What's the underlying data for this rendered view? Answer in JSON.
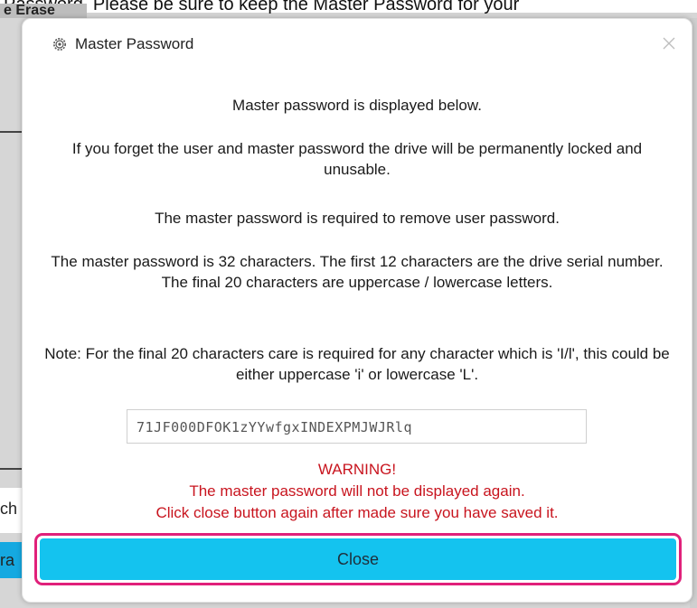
{
  "background": {
    "top_text": "Password. Please be sure to keep the Master Password for your",
    "tab_label": "e Erase",
    "left_fragment_1": "ch",
    "left_fragment_2": "ra"
  },
  "dialog": {
    "title": "Master Password",
    "app_icon": "gear-icon",
    "close_icon": "close-icon",
    "messages": [
      "Master password is displayed below.",
      "If you forget the user and master password the drive will be permanently locked and unusable.",
      "The master password is required to remove user password.",
      "The master password is 32 characters. The first 12 characters are the drive serial number. The final 20 characters are uppercase / lowercase letters.",
      "Note: For the final 20 characters care is required for any character which is 'I/l', this could be either uppercase 'i' or lowercase 'L'."
    ],
    "password_value": "71JF000DFOK1zYYwfgxINDEXPMJWJRlq",
    "warning": [
      "WARNING!",
      "The master password will not be displayed again.",
      "Click close button again after made sure you have saved it."
    ],
    "close_button_label": "Close",
    "colors": {
      "warning": "#c8141e",
      "button": "#14c3ef",
      "highlight": "#e0207a"
    }
  }
}
